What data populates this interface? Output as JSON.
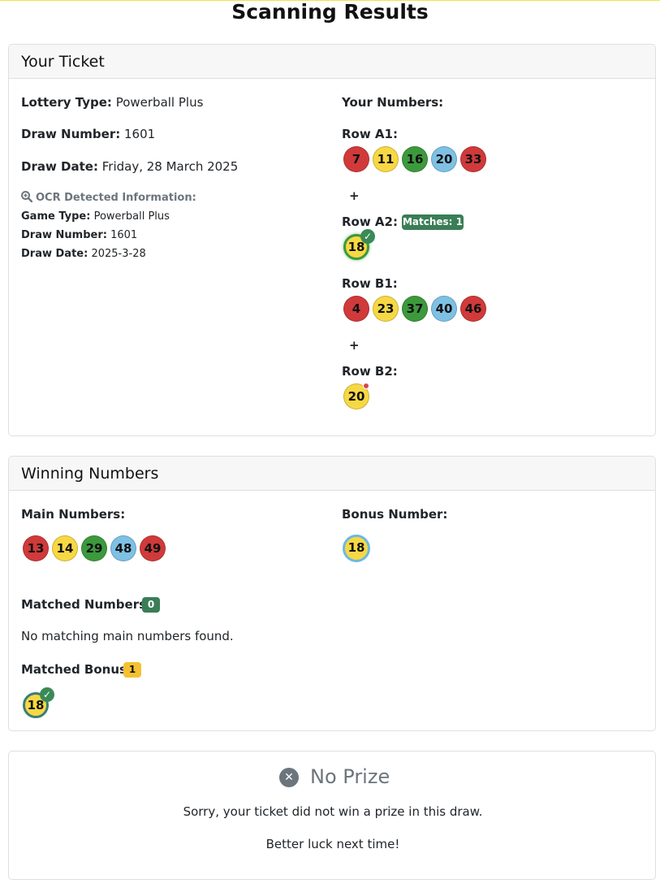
{
  "page": {
    "title": "Scanning Results"
  },
  "ticket": {
    "header": "Your Ticket",
    "lottery_type_label": "Lottery Type:",
    "lottery_type_value": "Powerball Plus",
    "draw_number_label": "Draw Number:",
    "draw_number_value": "1601",
    "draw_date_label": "Draw Date:",
    "draw_date_value": "Friday, 28 March 2025",
    "ocr": {
      "header": "OCR Detected Information:",
      "game_type_label": "Game Type:",
      "game_type_value": "Powerball Plus",
      "draw_number_label": "Draw Number:",
      "draw_number_value": "1601",
      "draw_date_label": "Draw Date:",
      "draw_date_value": "2025-3-28"
    },
    "your_numbers_label": "Your Numbers:",
    "rows": {
      "a1": {
        "label": "Row A1:",
        "balls": [
          "7",
          "11",
          "16",
          "20",
          "33"
        ]
      },
      "plus_a": "+",
      "a2": {
        "label": "Row A2:",
        "badge": "Matches: 1",
        "balls": [
          "18"
        ]
      },
      "b1": {
        "label": "Row B1:",
        "balls": [
          "4",
          "23",
          "37",
          "40",
          "46"
        ]
      },
      "plus_b": "+",
      "b2": {
        "label": "Row B2:",
        "balls": [
          "20"
        ]
      }
    }
  },
  "winning": {
    "header": "Winning Numbers",
    "main_label": "Main Numbers:",
    "main_balls": [
      "13",
      "14",
      "29",
      "48",
      "49"
    ],
    "bonus_label": "Bonus Number:",
    "bonus_ball": "18",
    "matched_numbers_label": "Matched Numbers:",
    "matched_numbers_count": "0",
    "no_match_text": "No matching main numbers found.",
    "matched_bonus_label": "Matched Bonus:",
    "matched_bonus_count": "1",
    "matched_bonus_ball": "18"
  },
  "result": {
    "title": "No Prize",
    "message": "Sorry, your ticket did not win a prize in this draw.",
    "footer": "Better luck next time!"
  },
  "colors": {
    "red": "#d03a3a",
    "yellow": "#f7d844",
    "green": "#3c9a3c",
    "blue": "#7ec1e5",
    "match_badge": "#3a7d56",
    "bonus_badge": "#f5c131"
  },
  "icons": {
    "ocr": "magnifier-plus-icon",
    "check": "check-icon",
    "no_prize": "close-circle-icon"
  }
}
